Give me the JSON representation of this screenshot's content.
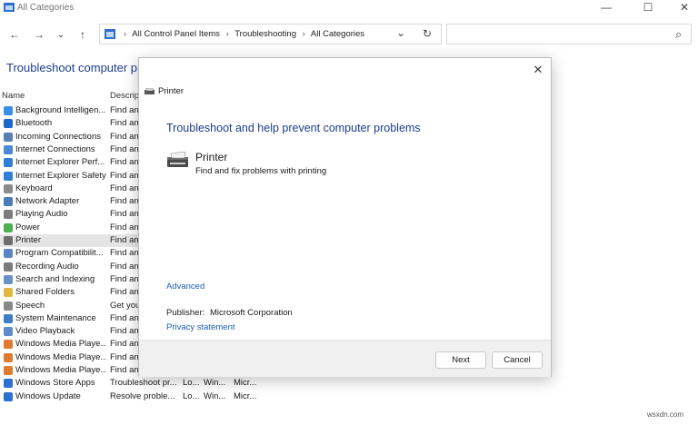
{
  "window": {
    "title": "All Categories",
    "minimize_glyph": "—",
    "maximize_glyph": "☐",
    "close_glyph": "✕"
  },
  "nav": {
    "back_glyph": "←",
    "forward_glyph": "→",
    "recent_glyph": "⌄",
    "up_glyph": "↑",
    "dropdown_glyph": "⌄",
    "refresh_glyph": "↻",
    "search_glyph": "⌕",
    "breadcrumb": [
      "All Control Panel Items",
      "Troubleshooting",
      "All Categories"
    ],
    "breadcrumb_sep": "›"
  },
  "page": {
    "title": "Troubleshoot computer pr",
    "columns": {
      "name": "Name",
      "description": "Descrip"
    },
    "rows": [
      {
        "name": "Background Intelligen...",
        "desc": "Find an",
        "color": "#3a8ee6"
      },
      {
        "name": "Bluetooth",
        "desc": "Find an",
        "color": "#1e66c8"
      },
      {
        "name": "Incoming Connections",
        "desc": "Find an",
        "color": "#5a7fb6"
      },
      {
        "name": "Internet Connections",
        "desc": "Find an",
        "color": "#4b88d6"
      },
      {
        "name": "Internet Explorer Perf...",
        "desc": "Find an",
        "color": "#2f7fd6"
      },
      {
        "name": "Internet Explorer Safety",
        "desc": "Find an",
        "color": "#2f7fd6"
      },
      {
        "name": "Keyboard",
        "desc": "Find an",
        "color": "#8a8a8a"
      },
      {
        "name": "Network Adapter",
        "desc": "Find an",
        "color": "#4c7bb8"
      },
      {
        "name": "Playing Audio",
        "desc": "Find an",
        "color": "#7c7c7c"
      },
      {
        "name": "Power",
        "desc": "Find an",
        "color": "#4caf50"
      },
      {
        "name": "Printer",
        "desc": "Find an",
        "color": "#6d6d6d",
        "selected": true
      },
      {
        "name": "Program Compatibilit...",
        "desc": "Find an",
        "color": "#5b86c5"
      },
      {
        "name": "Recording Audio",
        "desc": "Find an",
        "color": "#7a7a7a"
      },
      {
        "name": "Search and Indexing",
        "desc": "Find an",
        "color": "#6a90c6"
      },
      {
        "name": "Shared Folders",
        "desc": "Find an",
        "color": "#e2b73f"
      },
      {
        "name": "Speech",
        "desc": "Get you",
        "color": "#888888"
      },
      {
        "name": "System Maintenance",
        "desc": "Find an",
        "color": "#3f7dc4"
      },
      {
        "name": "Video Playback",
        "desc": "Find an",
        "color": "#5c8ccc"
      },
      {
        "name": "Windows Media Playe...",
        "desc": "Find an",
        "color": "#e07a2f"
      },
      {
        "name": "Windows Media Playe...",
        "desc": "Find an",
        "color": "#e07a2f"
      },
      {
        "name": "Windows Media Playe...",
        "desc": "Find an",
        "color": "#e07a2f"
      },
      {
        "name": "Windows Store Apps",
        "desc": "Troubleshoot pr...",
        "c3": "Lo...",
        "c4": "Win...",
        "c5": "Micr...",
        "color": "#2b6fd0"
      },
      {
        "name": "Windows Update",
        "desc": "Resolve proble...",
        "c3": "Lo...",
        "c4": "Win...",
        "c5": "Micr...",
        "color": "#2b6fd0"
      }
    ]
  },
  "dialog": {
    "close_glyph": "✕",
    "title": "Printer",
    "heading": "Troubleshoot and help prevent computer problems",
    "task_title": "Printer",
    "task_desc": "Find and fix problems with printing",
    "advanced_link": "Advanced",
    "publisher_label": "Publisher:",
    "publisher_value": "Microsoft Corporation",
    "privacy_link": "Privacy statement",
    "next_button": "Next",
    "cancel_button": "Cancel"
  },
  "watermark": "wsxdn.com"
}
